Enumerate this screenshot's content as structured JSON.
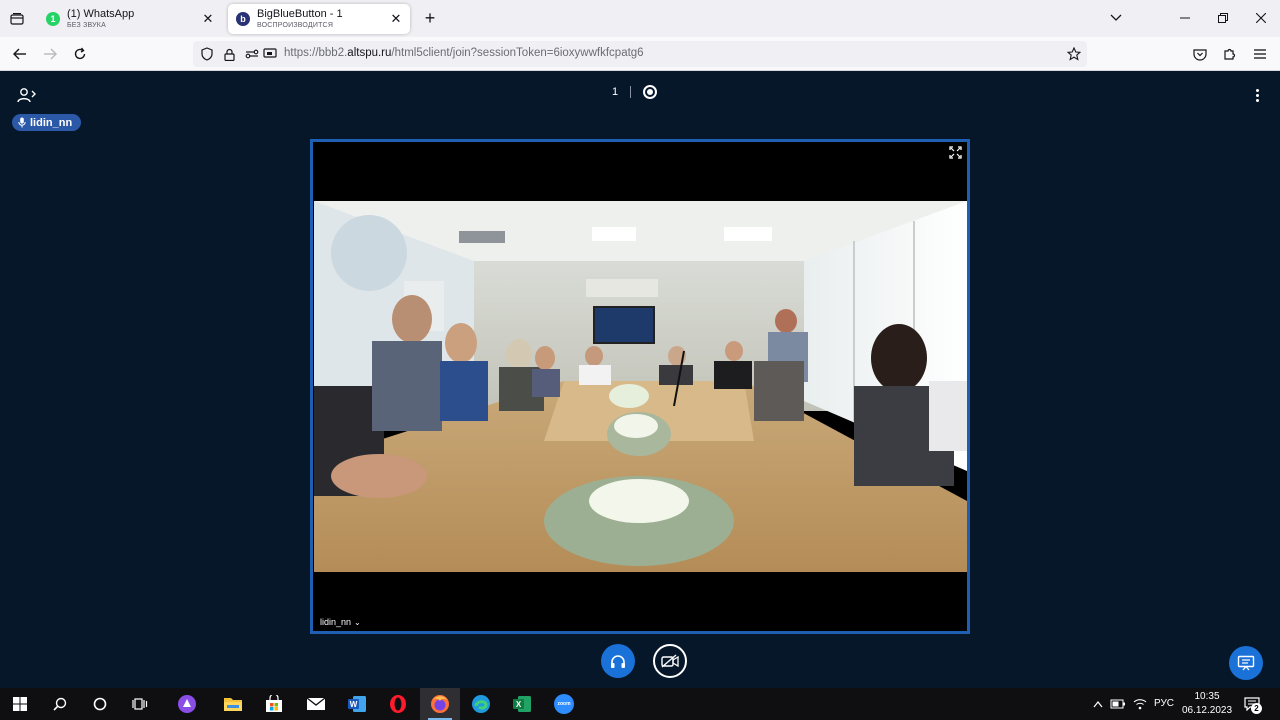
{
  "browser": {
    "tabs": [
      {
        "title": "(1) WhatsApp",
        "subtitle": "БЕЗ ЗВУКА",
        "favicon_badge": "1",
        "favicon_color": "#25d366",
        "active": false
      },
      {
        "title": "BigBlueButton - 1",
        "subtitle": "ВОСПРОИЗВОДИТСЯ",
        "favicon_badge": "b",
        "favicon_color": "#283274",
        "active": true
      }
    ],
    "url_prefix": "https://bbb2.",
    "url_host": "altspu.ru",
    "url_path": "/html5client/join?sessionToken=6ioxywwfkfcpatg6"
  },
  "app": {
    "talking_user": "lidin_nn",
    "meeting_number": "1",
    "webcam": {
      "user_name": "lidin_nn",
      "caret": "⌄"
    },
    "colors": {
      "background": "#06172a",
      "accent": "#1a71d8",
      "talking": "#2c58a8",
      "video_border": "#1f5fb2"
    }
  },
  "taskbar": {
    "apps": [
      "search-icon",
      "cortana-icon",
      "task-view-icon",
      "alice-icon",
      "file-explorer-icon",
      "store-icon",
      "mail-icon",
      "word-icon",
      "opera-icon",
      "firefox-icon",
      "edge-icon",
      "excel-icon",
      "zoom-icon"
    ],
    "zoom_label": "zoom",
    "language": "РУС",
    "time": "10:35",
    "date": "06.12.2023",
    "notifications": "2"
  }
}
